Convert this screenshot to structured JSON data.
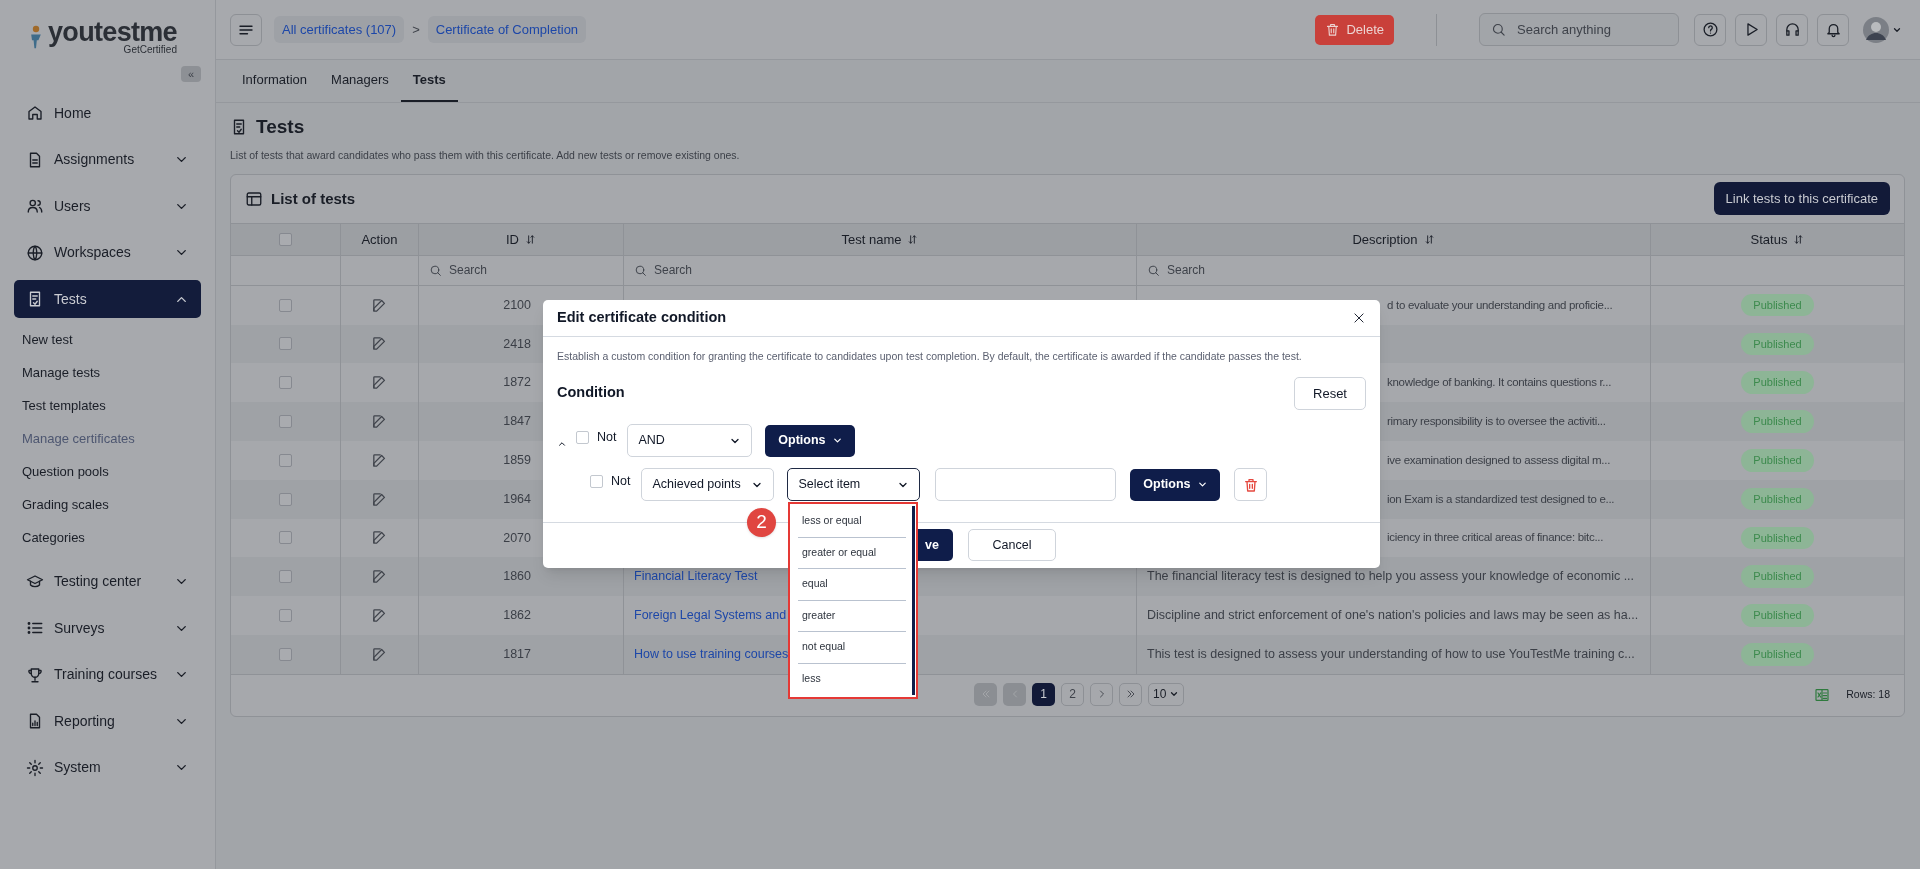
{
  "logo": {
    "wordmark": "youtestme",
    "tagline": "GetCertified"
  },
  "sidebar": {
    "collapse": "«",
    "items": [
      {
        "label": "Home"
      },
      {
        "label": "Assignments",
        "expanded": false
      },
      {
        "label": "Users",
        "expanded": false
      },
      {
        "label": "Workspaces",
        "expanded": false
      },
      {
        "label": "Tests",
        "expanded": true,
        "selected": true,
        "children": [
          {
            "label": "New test",
            "selected": false
          },
          {
            "label": "Manage tests",
            "selected": false
          },
          {
            "label": "Test templates",
            "selected": false
          },
          {
            "label": "Manage certificates",
            "selected": true
          },
          {
            "label": "Question pools",
            "selected": false
          },
          {
            "label": "Grading scales",
            "selected": false
          },
          {
            "label": "Categories",
            "selected": false
          }
        ]
      },
      {
        "label": "Testing center",
        "expanded": false
      },
      {
        "label": "Surveys",
        "expanded": false
      },
      {
        "label": "Training courses",
        "expanded": false
      },
      {
        "label": "Reporting",
        "expanded": false
      },
      {
        "label": "System",
        "expanded": false
      }
    ]
  },
  "breadcrumb": [
    "All certificates (107)",
    "Certificate of Completion"
  ],
  "breadcrumb_separator": ">",
  "delete_button": "Delete",
  "search": {
    "placeholder": "Search anything"
  },
  "tabs": [
    {
      "label": "Information",
      "selected": false
    },
    {
      "label": "Managers",
      "selected": false
    },
    {
      "label": "Tests",
      "selected": true
    }
  ],
  "page": {
    "title": "Tests",
    "description": "List of tests that award candidates who pass them with this certificate. Add new tests or remove existing ones."
  },
  "table": {
    "title": "List of tests",
    "link_button": "Link tests to this certificate",
    "select_all": {
      "checked": false
    },
    "columns": [
      {
        "label": "Action",
        "sortable": false
      },
      {
        "label": "ID",
        "sortable": true,
        "filter_placeholder": "Search"
      },
      {
        "label": "Test name",
        "sortable": true,
        "filter_placeholder": "Search"
      },
      {
        "label": "Description",
        "sortable": true,
        "filter_placeholder": "Search"
      },
      {
        "label": "Status",
        "sortable": true
      }
    ],
    "rows": [
      {
        "checked": false,
        "id": "2100",
        "description": "d to evaluate your understanding and proficie...",
        "status": "Published"
      },
      {
        "checked": false,
        "id": "2418",
        "status": "Published"
      },
      {
        "checked": false,
        "id": "1872",
        "description": "knowledge of banking. It contains questions r...",
        "status": "Published"
      },
      {
        "checked": false,
        "id": "1847",
        "description": "rimary responsibility is to oversee the activiti...",
        "status": "Published"
      },
      {
        "checked": false,
        "id": "1859",
        "description": "ive examination designed to assess digital m...",
        "status": "Published"
      },
      {
        "checked": false,
        "id": "1964",
        "description": "ion Exam is a standardized test designed to e...",
        "status": "Published"
      },
      {
        "checked": false,
        "id": "2070",
        "description": "iciency in three critical areas of finance: bitc...",
        "status": "Published"
      },
      {
        "checked": false,
        "id": "1860",
        "test_name": "Financial Literacy Test",
        "description": "The financial literacy test is designed to help you assess your knowledge of economic ...",
        "status": "Published"
      },
      {
        "checked": false,
        "id": "1862",
        "test_name": "Foreign Legal Systems and",
        "description": "Discipline and strict enforcement of one's nation's policies and laws may be seen as ha...",
        "status": "Published"
      },
      {
        "checked": false,
        "id": "1817",
        "test_name": "How to use training courses",
        "description": "This test is designed to assess your understanding of how to use YouTestMe training c...",
        "status": "Published"
      }
    ],
    "pagination": {
      "pages": [
        {
          "label": "1",
          "selected": true
        },
        {
          "label": "2",
          "selected": false
        }
      ],
      "page_size": "10"
    },
    "rows_count": "Rows: 18"
  },
  "modal": {
    "title": "Edit certificate condition",
    "description": "Establish a custom condition for granting the certificate to candidates upon test completion. By default, the certificate is awarded if the candidate passes the test.",
    "condition_label": "Condition",
    "reset_button": "Reset",
    "group": {
      "expanded": true,
      "not": {
        "label": "Not",
        "checked": false
      },
      "operator": "AND",
      "options_button": "Options"
    },
    "rule": {
      "not": {
        "label": "Not",
        "checked": false
      },
      "field": "Achieved points",
      "comparator": {
        "placeholder": "Select item",
        "open": true
      },
      "options_button": "Options"
    },
    "dropdown": [
      "less or equal",
      "greater or equal",
      "equal",
      "greater",
      "not equal",
      "less"
    ],
    "save_button": "ve",
    "cancel_button": "Cancel"
  },
  "callout": "2"
}
